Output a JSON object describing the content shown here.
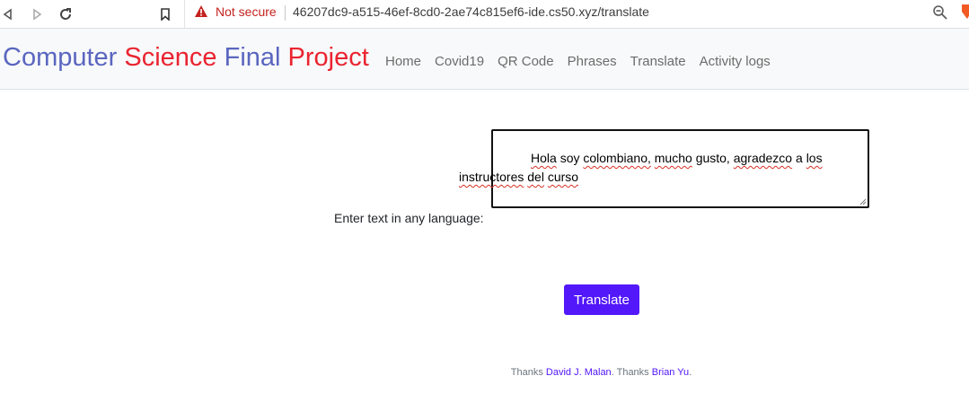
{
  "browser": {
    "security_label": "Not secure",
    "url": "46207dc9-a515-46ef-8cd0-2ae74c815ef6-ide.cs50.xyz/translate"
  },
  "navbar": {
    "brand": [
      "Computer",
      "Science",
      "Final",
      "Project"
    ],
    "links": [
      "Home",
      "Covid19",
      "QR Code",
      "Phrases",
      "Translate",
      "Activity logs"
    ]
  },
  "form": {
    "label": "Enter text in any language:",
    "text_words": [
      "Hola",
      "soy",
      "colombiano,",
      "mucho",
      "gusto,",
      "agradezco",
      "a",
      "los",
      "instructores",
      "del",
      "curso"
    ],
    "button_label": "Translate"
  },
  "footer": {
    "prefix": "Thanks",
    "name1": "David J. Malan",
    "middle": ". Thanks",
    "name2": "Brian Yu",
    "suffix": "."
  },
  "colors": {
    "brand_blue": "#5a66c0",
    "brand_red": "#ea2430",
    "button": "#5218fa",
    "link": "#5218fa"
  }
}
